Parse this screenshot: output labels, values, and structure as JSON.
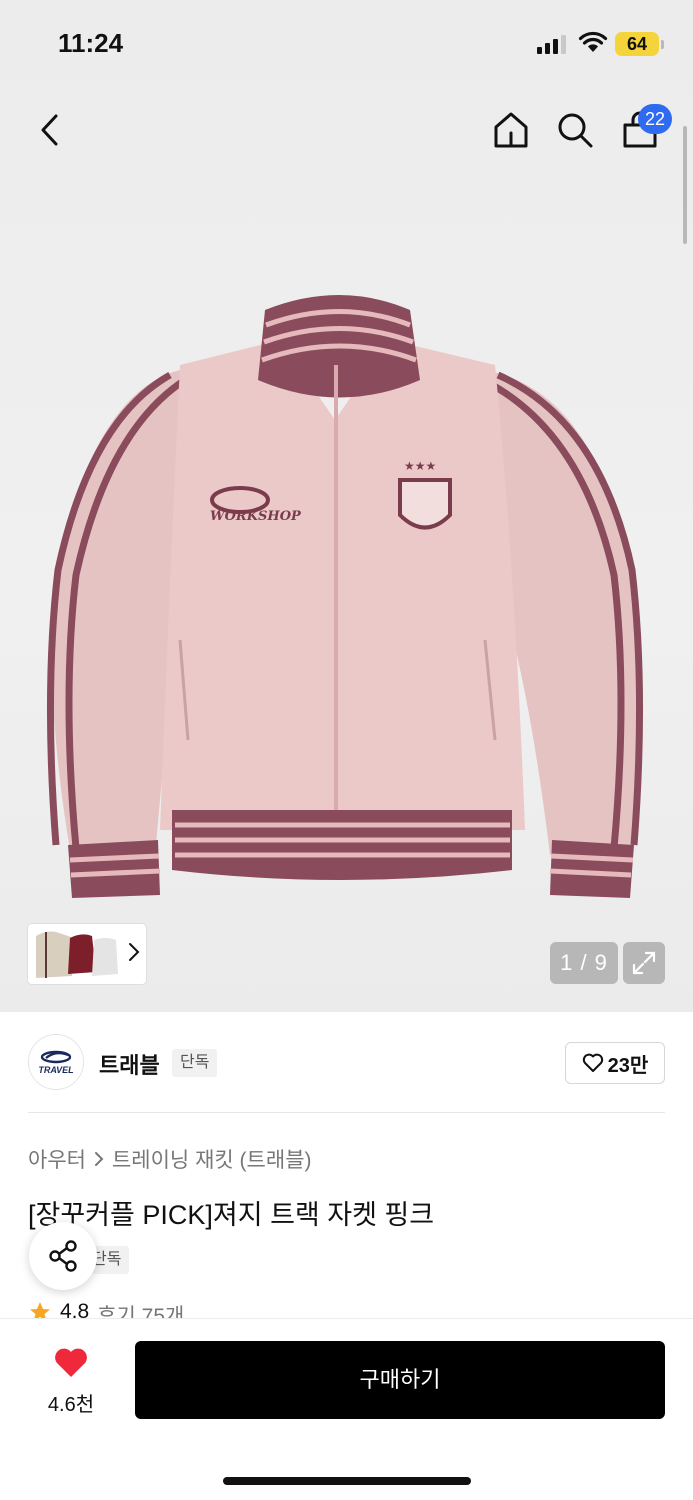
{
  "status_bar": {
    "time": "11:24",
    "battery": "64"
  },
  "nav": {
    "cart_count": "22"
  },
  "gallery": {
    "counter": "1 / 9"
  },
  "brand": {
    "logo_text": "TRAVEL",
    "name": "트래블",
    "tag": "단독",
    "likes": "23만"
  },
  "product": {
    "breadcrumb": [
      "아우터",
      "트레이닝 재킷 (트래블)"
    ],
    "title": "[장꾸커플 PICK]져지 트랙 자켓 핑크",
    "tag": "단독",
    "rating": "4.8",
    "reviews": "후기 75개"
  },
  "bottom": {
    "wish_count": "4.6천",
    "buy_label": "구매하기"
  },
  "colors": {
    "jacket_pink": "#e9c6c6",
    "jacket_stripe": "#8a4c5c",
    "badge_blue": "#2f6bf0",
    "heart_red": "#f0283c"
  }
}
